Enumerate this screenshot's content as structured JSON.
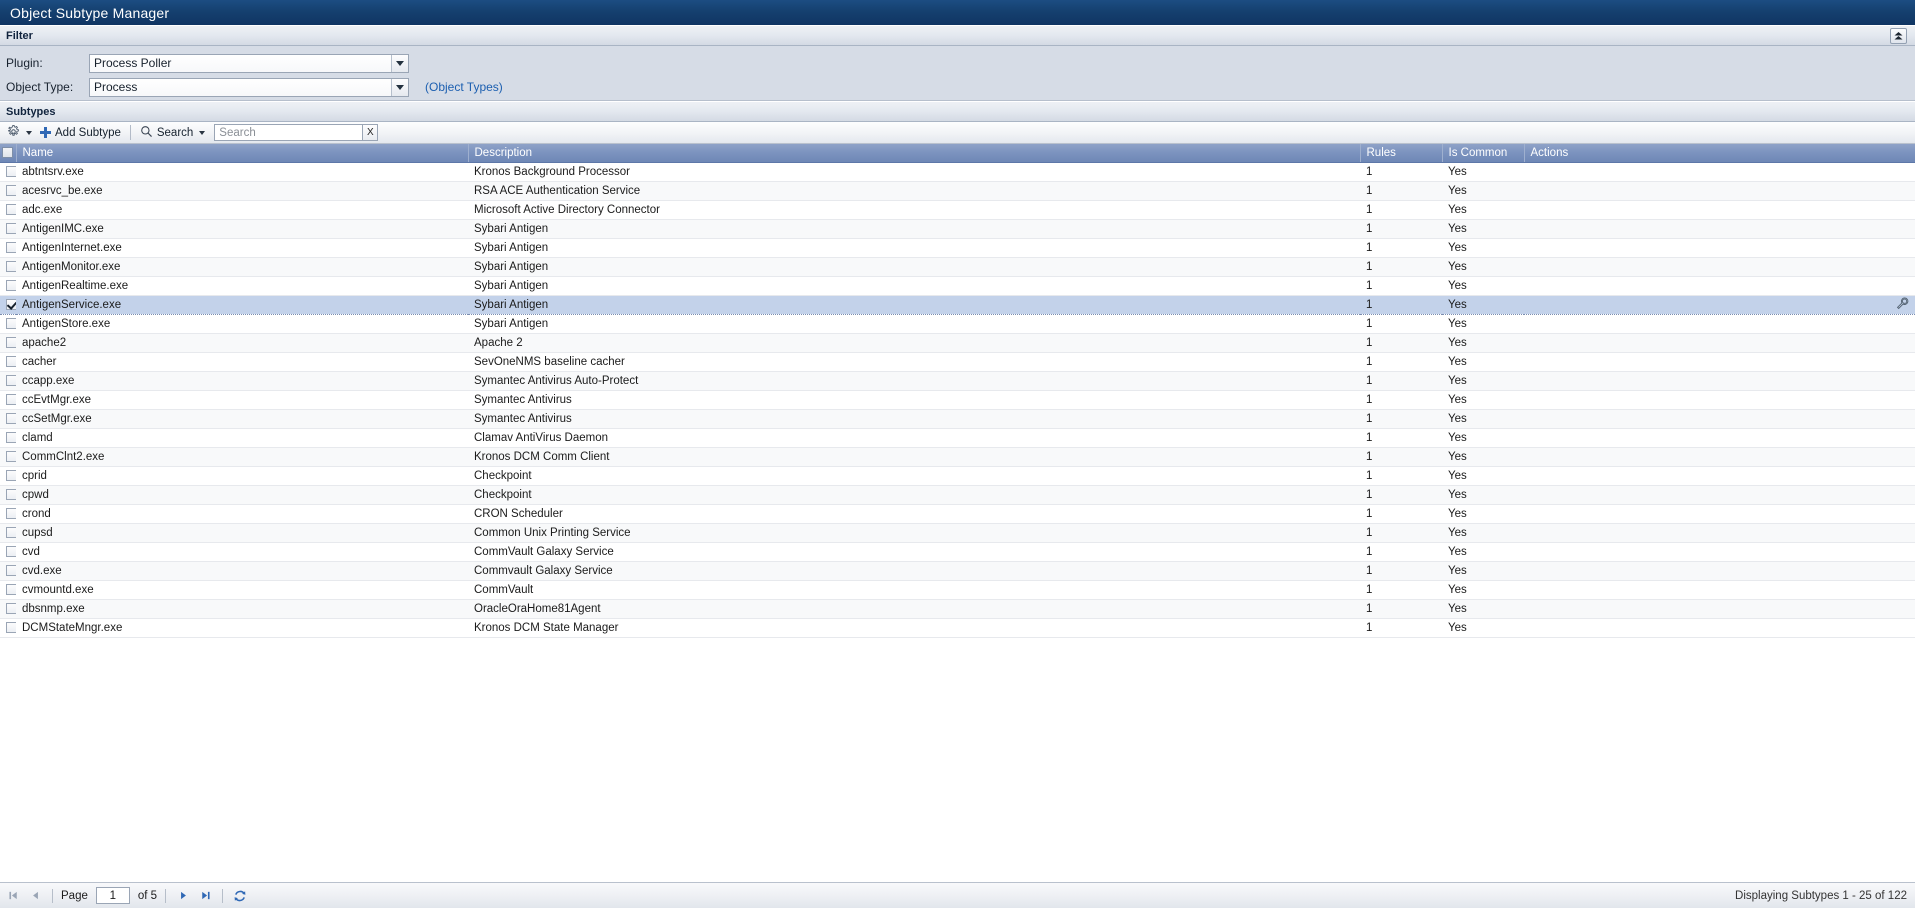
{
  "window": {
    "title": "Object Subtype Manager"
  },
  "filter": {
    "section_label": "Filter",
    "collapse_icon": "collapse-up-icon",
    "plugin_label": "Plugin:",
    "plugin_value": "Process Poller",
    "object_type_label": "Object Type:",
    "object_type_value": "Process",
    "object_types_link": "(Object Types)"
  },
  "subtypes": {
    "section_label": "Subtypes",
    "toolbar": {
      "gear_icon": "gear-icon",
      "add_label": "Add Subtype",
      "add_icon": "plus-icon",
      "search_label": "Search",
      "search_icon": "magnifier-icon",
      "search_value": "",
      "search_placeholder": "Search",
      "clear_label": "X"
    },
    "columns": [
      "Name",
      "Description",
      "Rules",
      "Is Common",
      "Actions"
    ],
    "rows": [
      {
        "name": "abtntsrv.exe",
        "description": "Kronos Background Processor",
        "rules": "1",
        "is_common": "Yes",
        "selected": false,
        "action_icon": ""
      },
      {
        "name": "acesrvc_be.exe",
        "description": "RSA ACE Authentication Service",
        "rules": "1",
        "is_common": "Yes",
        "selected": false,
        "action_icon": ""
      },
      {
        "name": "adc.exe",
        "description": "Microsoft Active Directory Connector",
        "rules": "1",
        "is_common": "Yes",
        "selected": false,
        "action_icon": ""
      },
      {
        "name": "AntigenIMC.exe",
        "description": "Sybari Antigen",
        "rules": "1",
        "is_common": "Yes",
        "selected": false,
        "action_icon": ""
      },
      {
        "name": "AntigenInternet.exe",
        "description": "Sybari Antigen",
        "rules": "1",
        "is_common": "Yes",
        "selected": false,
        "action_icon": ""
      },
      {
        "name": "AntigenMonitor.exe",
        "description": "Sybari Antigen",
        "rules": "1",
        "is_common": "Yes",
        "selected": false,
        "action_icon": ""
      },
      {
        "name": "AntigenRealtime.exe",
        "description": "Sybari Antigen",
        "rules": "1",
        "is_common": "Yes",
        "selected": false,
        "action_icon": ""
      },
      {
        "name": "AntigenService.exe",
        "description": "Sybari Antigen",
        "rules": "1",
        "is_common": "Yes",
        "selected": true,
        "action_icon": "wrench-icon"
      },
      {
        "name": "AntigenStore.exe",
        "description": "Sybari Antigen",
        "rules": "1",
        "is_common": "Yes",
        "selected": false,
        "action_icon": ""
      },
      {
        "name": "apache2",
        "description": "Apache 2",
        "rules": "1",
        "is_common": "Yes",
        "selected": false,
        "action_icon": ""
      },
      {
        "name": "cacher",
        "description": "SevOneNMS baseline cacher",
        "rules": "1",
        "is_common": "Yes",
        "selected": false,
        "action_icon": ""
      },
      {
        "name": "ccapp.exe",
        "description": "Symantec Antivirus Auto-Protect",
        "rules": "1",
        "is_common": "Yes",
        "selected": false,
        "action_icon": ""
      },
      {
        "name": "ccEvtMgr.exe",
        "description": "Symantec Antivirus",
        "rules": "1",
        "is_common": "Yes",
        "selected": false,
        "action_icon": ""
      },
      {
        "name": "ccSetMgr.exe",
        "description": "Symantec Antivirus",
        "rules": "1",
        "is_common": "Yes",
        "selected": false,
        "action_icon": ""
      },
      {
        "name": "clamd",
        "description": "Clamav AntiVirus Daemon",
        "rules": "1",
        "is_common": "Yes",
        "selected": false,
        "action_icon": ""
      },
      {
        "name": "CommClnt2.exe",
        "description": "Kronos DCM Comm Client",
        "rules": "1",
        "is_common": "Yes",
        "selected": false,
        "action_icon": ""
      },
      {
        "name": "cprid",
        "description": "Checkpoint",
        "rules": "1",
        "is_common": "Yes",
        "selected": false,
        "action_icon": ""
      },
      {
        "name": "cpwd",
        "description": "Checkpoint",
        "rules": "1",
        "is_common": "Yes",
        "selected": false,
        "action_icon": ""
      },
      {
        "name": "crond",
        "description": "CRON Scheduler",
        "rules": "1",
        "is_common": "Yes",
        "selected": false,
        "action_icon": ""
      },
      {
        "name": "cupsd",
        "description": "Common Unix Printing Service",
        "rules": "1",
        "is_common": "Yes",
        "selected": false,
        "action_icon": ""
      },
      {
        "name": "cvd",
        "description": "CommVault Galaxy Service",
        "rules": "1",
        "is_common": "Yes",
        "selected": false,
        "action_icon": ""
      },
      {
        "name": "cvd.exe",
        "description": "Commvault Galaxy Service",
        "rules": "1",
        "is_common": "Yes",
        "selected": false,
        "action_icon": ""
      },
      {
        "name": "cvmountd.exe",
        "description": "CommVault",
        "rules": "1",
        "is_common": "Yes",
        "selected": false,
        "action_icon": ""
      },
      {
        "name": "dbsnmp.exe",
        "description": "OracleOraHome81Agent",
        "rules": "1",
        "is_common": "Yes",
        "selected": false,
        "action_icon": ""
      },
      {
        "name": "DCMStateMngr.exe",
        "description": "Kronos DCM State Manager",
        "rules": "1",
        "is_common": "Yes",
        "selected": false,
        "action_icon": ""
      }
    ]
  },
  "footer": {
    "first_icon": "first-page-icon",
    "prev_icon": "prev-page-icon",
    "page_label": "Page",
    "page_value": "1",
    "of_label": "of 5",
    "next_icon": "next-page-icon",
    "last_icon": "last-page-icon",
    "refresh_icon": "refresh-icon",
    "display_status": "Displaying Subtypes 1 - 25 of 122"
  },
  "colors": {
    "titlebar": "#15406f",
    "header_row": "#7c93bf",
    "selected_row": "#c3d2ea",
    "link": "#1c5fb0",
    "filter_bg": "#d6dce6"
  }
}
